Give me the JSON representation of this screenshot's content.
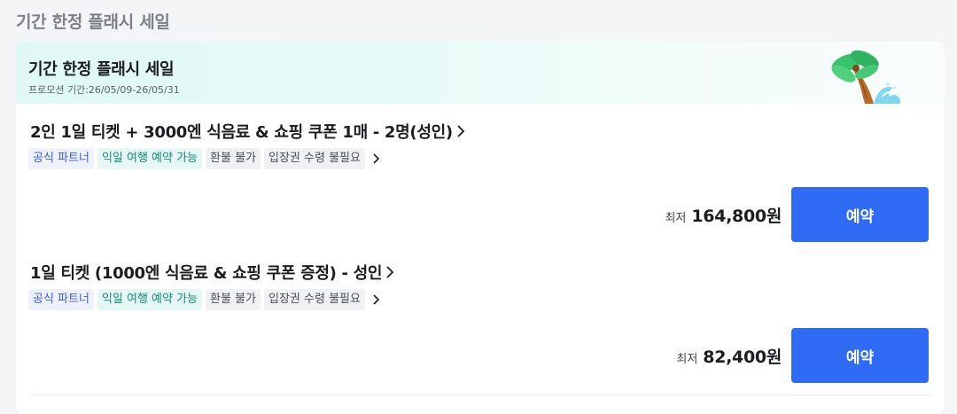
{
  "section": {
    "title": "기간 한정 플래시 세일"
  },
  "promo": {
    "title": "기간 한정 플래시 세일",
    "period": "프로모션 기간:26/05/09-26/05/31",
    "illustration": "palm-tree-wave-icon"
  },
  "products": [
    {
      "name": "2인 1일 티켓 + 3000엔 식음료 & 쇼핑 쿠폰 1매 - 2명(성인)",
      "tags": [
        "공식 파트너",
        "익일 여행 예약 가능",
        "환불 불가",
        "입장권 수령 불필요"
      ],
      "price_prefix": "최저",
      "price": "164,800원",
      "button_label": "예약"
    },
    {
      "name": "1일 티켓 (1000엔 식음료 & 쇼핑 쿠폰 증정) - 성인",
      "tags": [
        "공식 파트너",
        "익일 여행 예약 가능",
        "환불 불가",
        "입장권 수령 불필요"
      ],
      "price_prefix": "최저",
      "price": "82,400원",
      "button_label": "예약"
    }
  ],
  "colors": {
    "accent": "#2f6bf5",
    "partner_tag_text": "#3d5bd9",
    "nextday_tag_text": "#168b77",
    "promo_header_bg": "#dff8f6"
  }
}
